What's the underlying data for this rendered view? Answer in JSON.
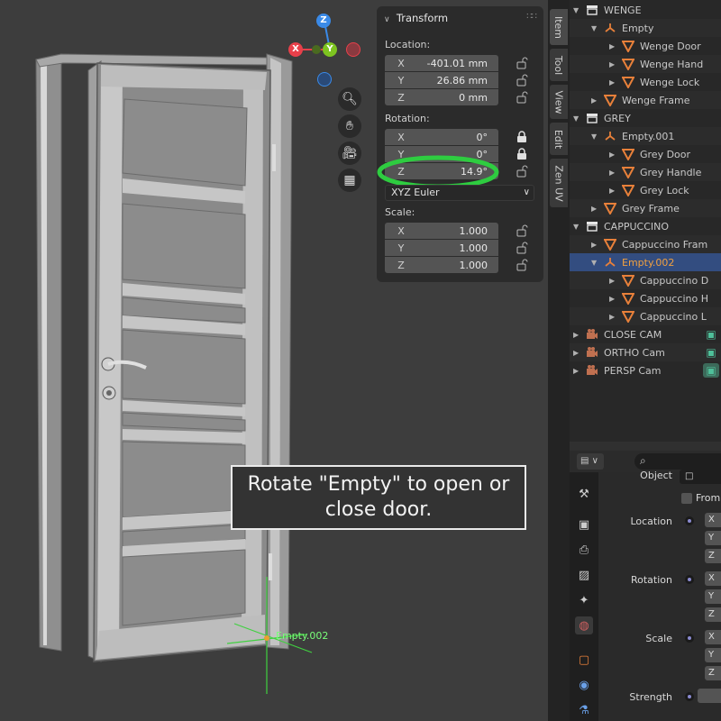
{
  "viewport": {
    "empty_label": "Empty.002",
    "gizmo": {
      "z": "Z",
      "y": "Y",
      "x": "X"
    },
    "overlay_text": "Rotate \"Empty\" to open or close door."
  },
  "npanel": {
    "header": "Transform",
    "location_label": "Location:",
    "location": [
      {
        "axis": "X",
        "value": "-401.01 mm"
      },
      {
        "axis": "Y",
        "value": "26.86 mm"
      },
      {
        "axis": "Z",
        "value": "0 mm"
      }
    ],
    "rotation_label": "Rotation:",
    "rotation": [
      {
        "axis": "X",
        "value": "0°"
      },
      {
        "axis": "Y",
        "value": "0°"
      },
      {
        "axis": "Z",
        "value": "14.9°"
      }
    ],
    "rotation_mode": "XYZ Euler",
    "scale_label": "Scale:",
    "scale": [
      {
        "axis": "X",
        "value": "1.000"
      },
      {
        "axis": "Y",
        "value": "1.000"
      },
      {
        "axis": "Z",
        "value": "1.000"
      }
    ],
    "highlight_color": "#2ecc40"
  },
  "tabs": [
    "Item",
    "Tool",
    "View",
    "Edit",
    "Zen UV"
  ],
  "outliner": {
    "rows": [
      {
        "label": "WENGE",
        "type": "collection"
      },
      {
        "label": "Empty",
        "type": "empty"
      },
      {
        "label": "Wenge Door",
        "type": "mesh"
      },
      {
        "label": "Wenge Hand",
        "type": "mesh"
      },
      {
        "label": "Wenge Lock",
        "type": "mesh"
      },
      {
        "label": "Wenge Frame",
        "type": "mesh"
      },
      {
        "label": "GREY",
        "type": "collection"
      },
      {
        "label": "Empty.001",
        "type": "empty"
      },
      {
        "label": "Grey Door",
        "type": "mesh"
      },
      {
        "label": "Grey Handle",
        "type": "mesh"
      },
      {
        "label": "Grey Lock",
        "type": "mesh"
      },
      {
        "label": "Grey Frame",
        "type": "mesh"
      },
      {
        "label": "CAPPUCCINO",
        "type": "collection"
      },
      {
        "label": "Cappuccino Fram",
        "type": "mesh"
      },
      {
        "label": "Empty.002",
        "type": "empty"
      },
      {
        "label": "Cappuccino D",
        "type": "mesh"
      },
      {
        "label": "Cappuccino H",
        "type": "mesh"
      },
      {
        "label": "Cappuccino L",
        "type": "mesh"
      },
      {
        "label": "CLOSE CAM",
        "type": "camera"
      },
      {
        "label": "ORTHO Cam",
        "type": "camera"
      },
      {
        "label": "PERSP Cam",
        "type": "camera"
      }
    ]
  },
  "properties": {
    "object_label": "Object",
    "from_label": "From",
    "location_label": "Location",
    "rotation_label": "Rotation",
    "scale_label": "Scale",
    "strength_label": "Strength",
    "field_letters": [
      "X",
      "Y",
      "Z"
    ]
  },
  "colors": {
    "selected_row": "#334d80",
    "active_text": "#f0a040",
    "mesh_icon": "#e8803a",
    "empty_icon": "#e8803a",
    "camera_icon": "#c07050",
    "axis_x": "#e8404a",
    "axis_y": "#7ec420",
    "axis_z": "#3a8ae8"
  }
}
